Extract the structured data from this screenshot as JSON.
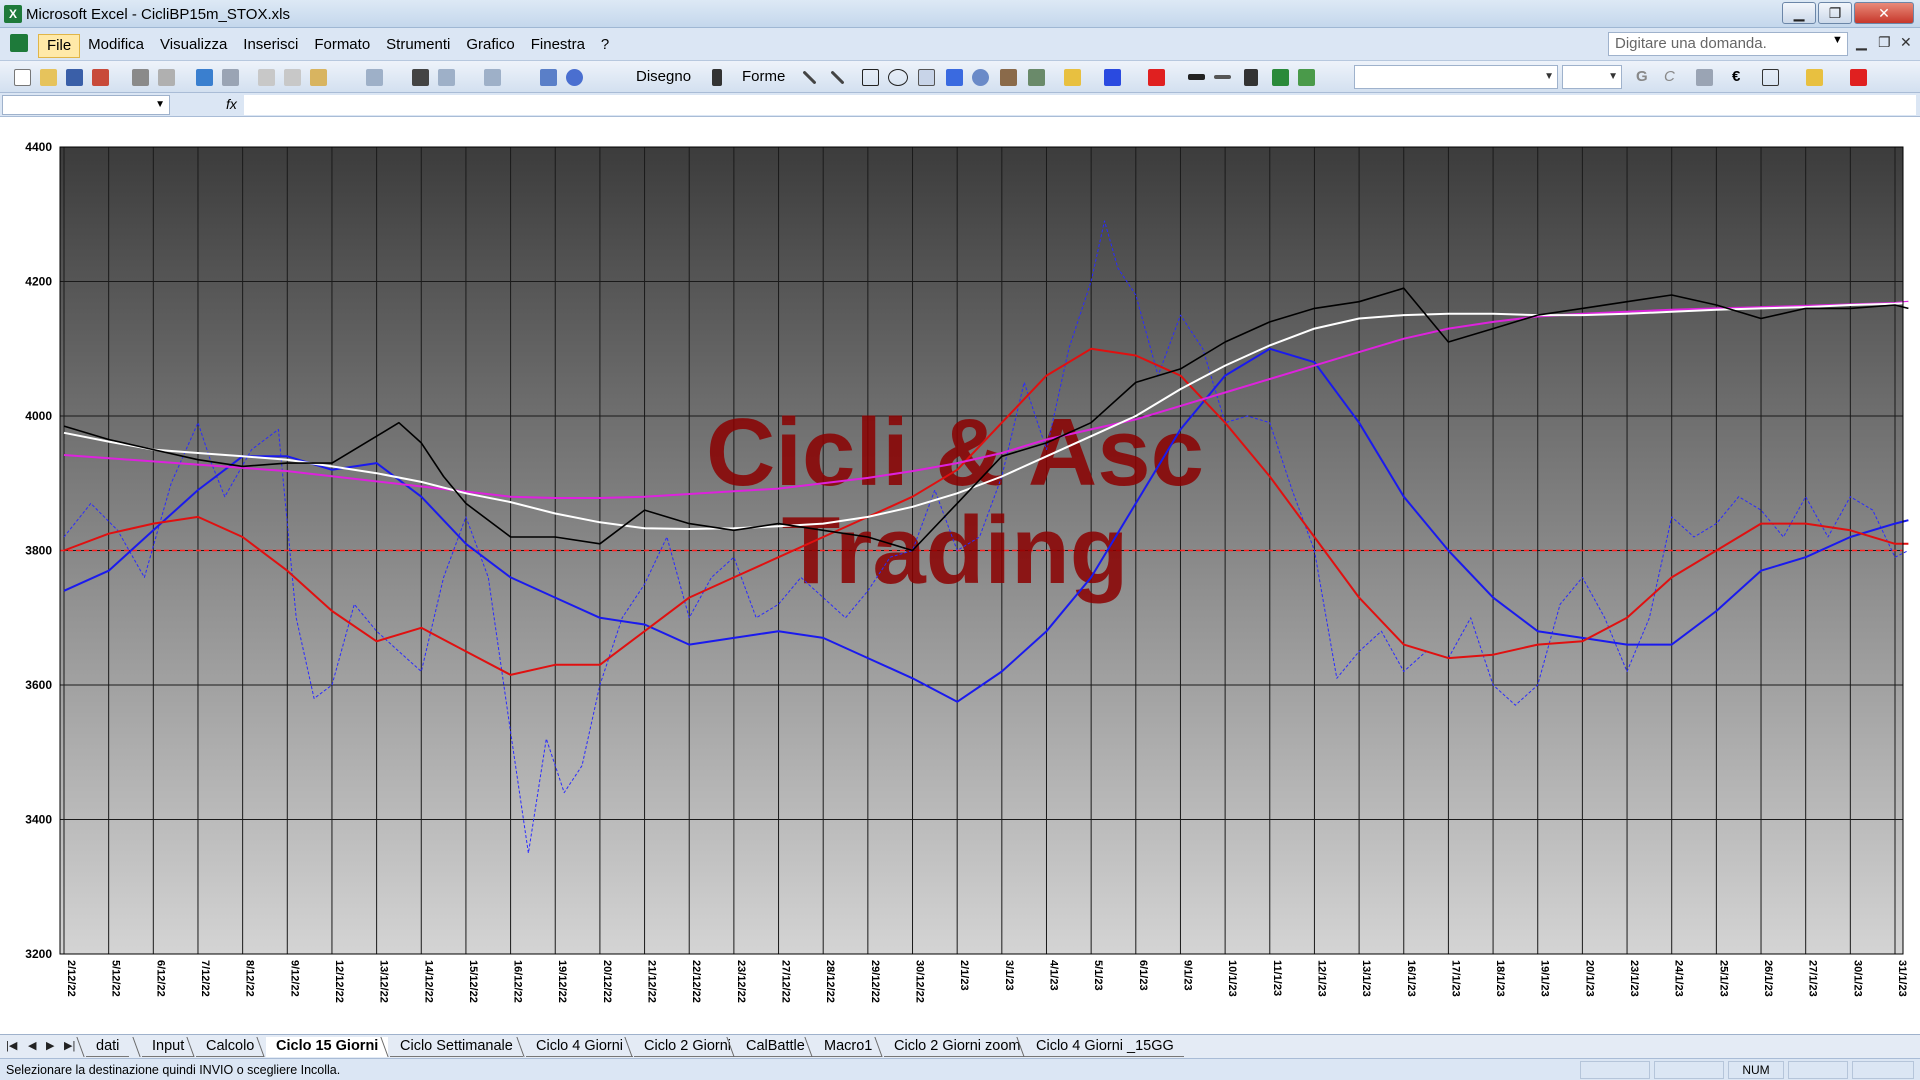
{
  "window": {
    "title": "Microsoft Excel - CicliBP15m_STOX.xls",
    "minimize_label": "▁",
    "maximize_label": "❐",
    "close_label": "✕"
  },
  "menu": {
    "items": [
      "File",
      "Modifica",
      "Visualizza",
      "Inserisci",
      "Formato",
      "Strumenti",
      "Grafico",
      "Finestra",
      "?"
    ],
    "help_placeholder": "Digitare una domanda.",
    "mdi_minimize": "▁",
    "mdi_restore": "❐",
    "mdi_close": "✕"
  },
  "toolbar": {
    "disegno_label": "Disegno",
    "forme_label": "Forme",
    "bold_label": "G",
    "italic_label": "C",
    "euro_label": "€"
  },
  "formula_bar": {
    "fx_label": "fx",
    "name_value": "",
    "formula_value": ""
  },
  "sheet_tabs": {
    "items": [
      "dati",
      "Input",
      "Calcolo",
      "Ciclo 15 Giorni",
      "Ciclo Settimanale",
      "Ciclo 4 Giorni",
      "Ciclo 2 Giorni",
      "CalBattle",
      "Macro1",
      "Ciclo 2 Giorni zoom",
      "Ciclo 4 Giorni _15GG"
    ],
    "active_index": 3
  },
  "status_bar": {
    "message": "Selezionare la destinazione quindi INVIO o scegliere Incolla.",
    "num_label": "NUM"
  },
  "chart_data": {
    "type": "line",
    "watermark": [
      "Cicli & Asc",
      "Trading"
    ],
    "y_ticks": [
      "4400",
      "4200",
      "4000",
      "3800",
      "3600",
      "3400",
      "3200"
    ],
    "ylim": [
      3200,
      4400
    ],
    "reference_line": 3800,
    "x_labels": [
      "2/12/22",
      "5/12/22",
      "6/12/22",
      "7/12/22",
      "8/12/22",
      "9/12/22",
      "12/12/22",
      "13/12/22",
      "14/12/22",
      "15/12/22",
      "16/12/22",
      "19/12/22",
      "20/12/22",
      "21/12/22",
      "22/12/22",
      "23/12/22",
      "27/12/22",
      "28/12/22",
      "29/12/22",
      "30/12/22",
      "2/1/23",
      "3/1/23",
      "4/1/23",
      "5/1/23",
      "6/1/23",
      "9/1/23",
      "10/1/23",
      "11/1/23",
      "12/1/23",
      "13/1/23",
      "16/1/23",
      "17/1/23",
      "18/1/23",
      "19/1/23",
      "20/1/23",
      "23/1/23",
      "24/1/23",
      "25/1/23",
      "26/1/23",
      "27/1/23",
      "30/1/23",
      "31/1/23"
    ],
    "colors": {
      "plot_top": "#3c3c3c",
      "plot_bottom": "#d4d4d4",
      "watermark": "#8b0000",
      "reference": "#ff2020"
    },
    "series": [
      {
        "color": "#000000",
        "style": "solid",
        "width": 1.6,
        "x": [
          0,
          1,
          2,
          3,
          4,
          5,
          6,
          7,
          7.5,
          8,
          8.5,
          9,
          10,
          11,
          12,
          13,
          14,
          15,
          16,
          17,
          18,
          19,
          20,
          21,
          22,
          23,
          24,
          25,
          26,
          27,
          28,
          29,
          30,
          31,
          32,
          33,
          34,
          35,
          36,
          37,
          38,
          39,
          40,
          41,
          41.3
        ],
        "y": [
          3985,
          3965,
          3950,
          3935,
          3925,
          3930,
          3930,
          3970,
          3990,
          3960,
          3910,
          3870,
          3820,
          3820,
          3810,
          3860,
          3840,
          3830,
          3840,
          3830,
          3820,
          3800,
          3870,
          3940,
          3960,
          3990,
          4050,
          4070,
          4110,
          4140,
          4160,
          4170,
          4190,
          4110,
          4130,
          4150,
          4160,
          4170,
          4180,
          4165,
          4145,
          4160,
          4160,
          4165,
          4160
        ]
      },
      {
        "color": "#ffffff",
        "style": "solid",
        "width": 2,
        "x": [
          0,
          1,
          2,
          3,
          4,
          5,
          6,
          7,
          8,
          9,
          10,
          11,
          12,
          13,
          14,
          15,
          16,
          17,
          18,
          19,
          20,
          21,
          22,
          23,
          24,
          25,
          26,
          27,
          28,
          29,
          30,
          31,
          32,
          33,
          34,
          35,
          36,
          37,
          38,
          39,
          40,
          41,
          41.3
        ],
        "y": [
          3975,
          3962,
          3950,
          3945,
          3940,
          3935,
          3925,
          3915,
          3902,
          3885,
          3872,
          3855,
          3842,
          3833,
          3832,
          3833,
          3836,
          3840,
          3850,
          3865,
          3885,
          3910,
          3940,
          3970,
          4000,
          4040,
          4075,
          4105,
          4130,
          4145,
          4150,
          4152,
          4152,
          4150,
          4150,
          4152,
          4155,
          4158,
          4160,
          4162,
          4165,
          4167,
          4168
        ]
      },
      {
        "color": "#dd22dd",
        "style": "solid",
        "width": 2,
        "x": [
          0,
          5,
          10,
          11,
          12,
          13,
          14,
          15,
          16,
          17,
          18,
          19,
          20,
          21,
          22,
          23,
          24,
          25,
          26,
          27,
          28,
          29,
          30,
          31,
          32,
          33,
          34,
          35,
          36,
          37,
          38,
          39,
          40,
          41,
          41.3
        ],
        "y": [
          3942,
          3918,
          3880,
          3878,
          3878,
          3880,
          3884,
          3888,
          3892,
          3900,
          3908,
          3918,
          3930,
          3945,
          3965,
          3980,
          3995,
          4015,
          4035,
          4055,
          4075,
          4095,
          4115,
          4130,
          4140,
          4148,
          4152,
          4155,
          4158,
          4160,
          4162,
          4164,
          4166,
          4168,
          4170
        ]
      },
      {
        "color": "#e01010",
        "style": "solid",
        "width": 2,
        "x": [
          0,
          1,
          2,
          3,
          4,
          5,
          6,
          7,
          8,
          9,
          10,
          11,
          12,
          13,
          14,
          15,
          16,
          17,
          18,
          19,
          20,
          21,
          22,
          23,
          24,
          25,
          26,
          27,
          28,
          29,
          30,
          31,
          32,
          33,
          34,
          35,
          36,
          37,
          38,
          39,
          40,
          41,
          41.3
        ],
        "y": [
          3800,
          3825,
          3840,
          3850,
          3820,
          3770,
          3710,
          3665,
          3685,
          3650,
          3615,
          3630,
          3630,
          3680,
          3730,
          3760,
          3790,
          3820,
          3850,
          3880,
          3920,
          3990,
          4060,
          4100,
          4090,
          4060,
          3990,
          3910,
          3820,
          3730,
          3660,
          3640,
          3645,
          3660,
          3665,
          3700,
          3760,
          3800,
          3840,
          3840,
          3830,
          3810,
          3810
        ]
      },
      {
        "color": "#1a1aee",
        "style": "solid",
        "width": 2,
        "x": [
          0,
          1,
          2,
          3,
          4,
          5,
          6,
          7,
          8,
          9,
          10,
          11,
          12,
          13,
          14,
          15,
          16,
          17,
          18,
          19,
          20,
          21,
          22,
          23,
          24,
          25,
          26,
          27,
          28,
          29,
          30,
          31,
          32,
          33,
          34,
          35,
          36,
          37,
          38,
          39,
          40,
          41,
          41.3
        ],
        "y": [
          3740,
          3770,
          3830,
          3890,
          3940,
          3940,
          3920,
          3930,
          3880,
          3810,
          3760,
          3730,
          3700,
          3690,
          3660,
          3670,
          3680,
          3670,
          3640,
          3610,
          3575,
          3620,
          3680,
          3760,
          3870,
          3980,
          4060,
          4100,
          4080,
          3990,
          3880,
          3800,
          3730,
          3680,
          3670,
          3660,
          3660,
          3710,
          3770,
          3790,
          3820,
          3840,
          3845
        ]
      },
      {
        "color": "#2a2aff",
        "style": "dashed",
        "width": 1,
        "x": [
          0,
          0.6,
          1.2,
          1.8,
          2.4,
          3,
          3.3,
          3.6,
          4.2,
          4.8,
          5.2,
          5.6,
          6,
          6.5,
          7,
          7.5,
          8,
          8.5,
          9,
          9.5,
          10,
          10.4,
          10.8,
          11.2,
          11.6,
          12,
          12.5,
          13,
          13.5,
          14,
          14.5,
          15,
          15.5,
          16,
          16.5,
          17,
          17.5,
          18,
          18.5,
          19,
          19.5,
          20,
          20.5,
          21,
          21.5,
          22,
          22.5,
          23,
          23.3,
          23.6,
          24,
          24.5,
          25,
          25.5,
          26,
          26.5,
          27,
          27.5,
          28,
          28.5,
          29,
          29.5,
          30,
          30.5,
          31,
          31.5,
          32,
          32.5,
          33,
          33.5,
          34,
          34.5,
          35,
          35.5,
          36,
          36.5,
          37,
          37.5,
          38,
          38.5,
          39,
          39.5,
          40,
          40.5,
          41,
          41.3
        ],
        "y": [
          3820,
          3870,
          3830,
          3760,
          3900,
          3990,
          3930,
          3880,
          3950,
          3980,
          3700,
          3580,
          3600,
          3720,
          3680,
          3650,
          3620,
          3760,
          3850,
          3760,
          3530,
          3350,
          3520,
          3440,
          3480,
          3600,
          3700,
          3750,
          3820,
          3700,
          3760,
          3790,
          3700,
          3720,
          3760,
          3730,
          3700,
          3740,
          3790,
          3800,
          3890,
          3800,
          3820,
          3910,
          4050,
          3950,
          4100,
          4200,
          4290,
          4220,
          4180,
          4060,
          4150,
          4100,
          3990,
          4000,
          3990,
          3890,
          3800,
          3610,
          3650,
          3680,
          3620,
          3650,
          3640,
          3700,
          3600,
          3570,
          3600,
          3720,
          3760,
          3700,
          3620,
          3700,
          3850,
          3820,
          3840,
          3880,
          3860,
          3820,
          3880,
          3820,
          3880,
          3860,
          3790,
          3800
        ]
      }
    ]
  }
}
